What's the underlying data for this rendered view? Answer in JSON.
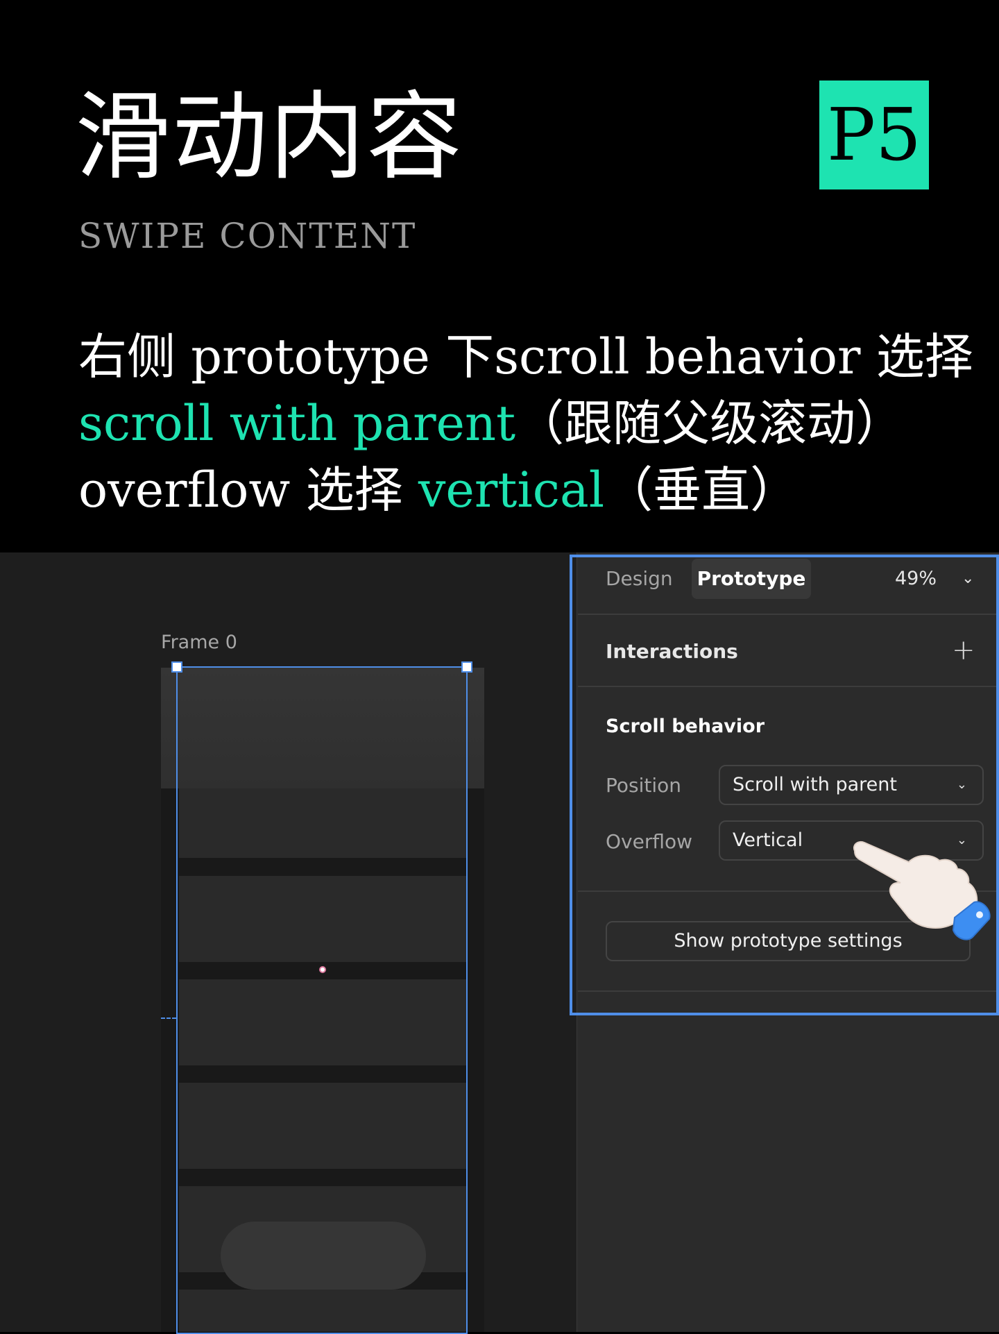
{
  "header": {
    "title": "滑动内容",
    "subtitle": "SWIPE CONTENT",
    "badge": "P5"
  },
  "description": {
    "line1": "右侧 prototype 下scroll behavior 选择",
    "line2_highlight": "scroll with parent",
    "line2_rest": "（跟随父级滚动）",
    "line3_a": "overflow 选择 ",
    "line3_highlight": "vertical",
    "line3_rest": "（垂直）"
  },
  "canvas": {
    "frame_label": "Frame 0"
  },
  "panel": {
    "tabs": {
      "design": "Design",
      "prototype": "Prototype"
    },
    "zoom": "49%",
    "interactions": "Interactions",
    "scroll_behavior": "Scroll behavior",
    "position_label": "Position",
    "position_value": "Scroll with parent",
    "overflow_label": "Overflow",
    "overflow_value": "Vertical",
    "show_settings": "Show prototype settings"
  },
  "colors": {
    "accent": "#1ee3b1",
    "selection": "#4f8ee8"
  },
  "icons": [
    "chevron-down-icon",
    "plus-icon",
    "pointing-hand-icon"
  ]
}
